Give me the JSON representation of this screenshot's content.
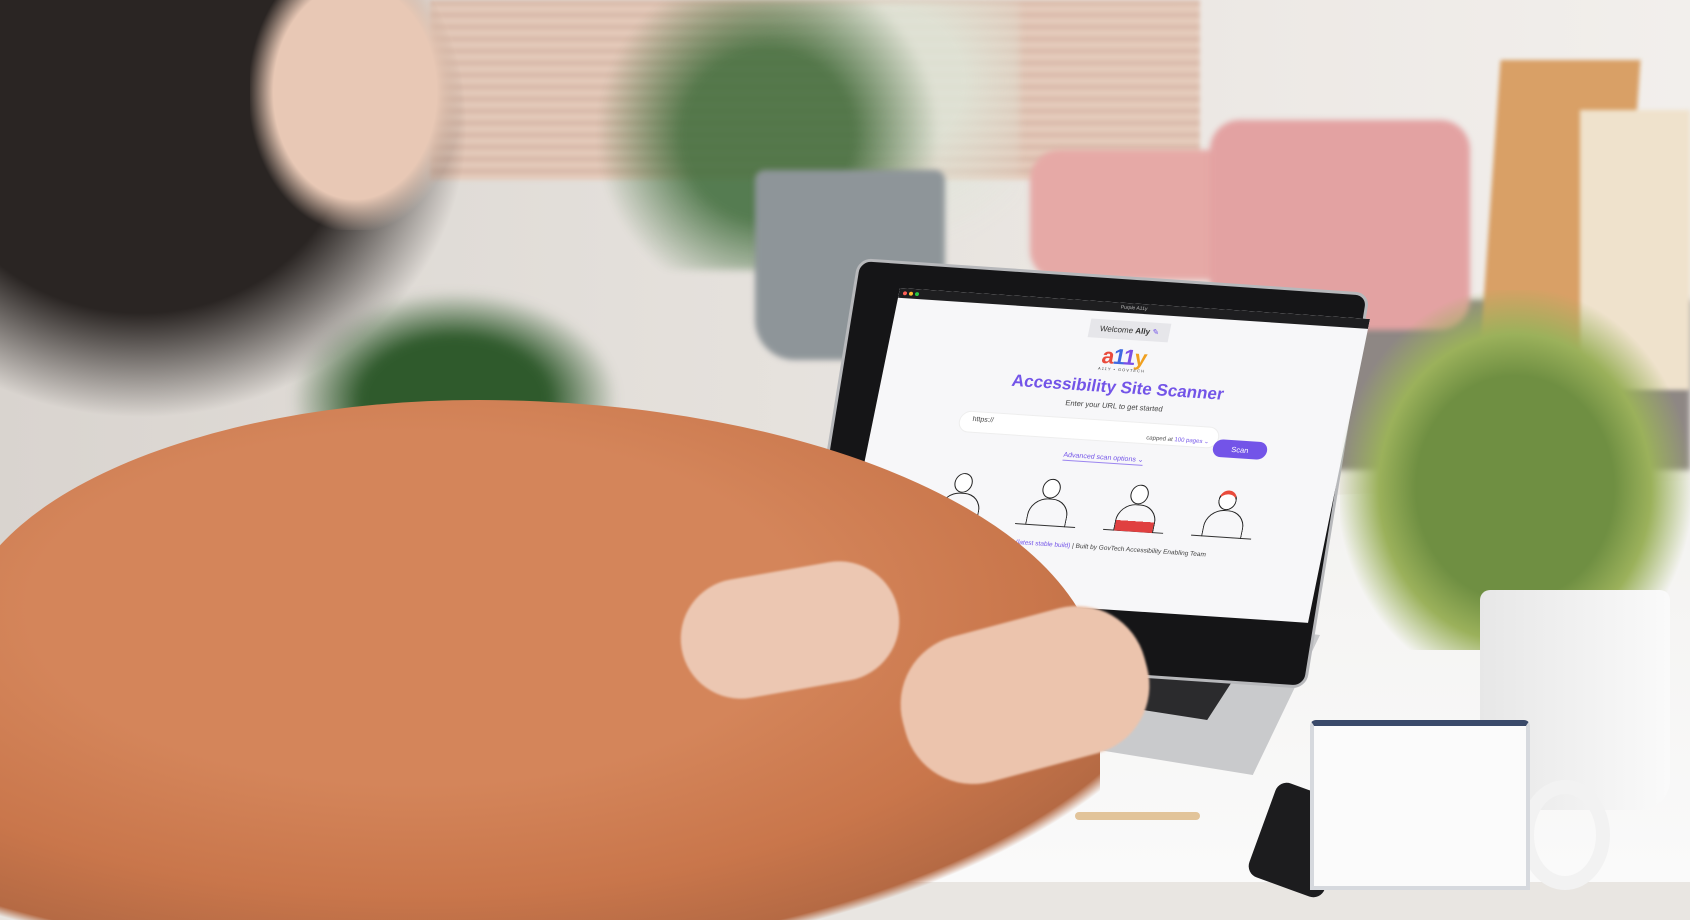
{
  "window": {
    "title": "Purple A11y"
  },
  "app": {
    "welcome_prefix": "Welcome",
    "welcome_name": "Ally",
    "logo_letters": [
      "a",
      "1",
      "1",
      "y"
    ],
    "logo_sub": "A11Y • GOVTECH",
    "heading": "Accessibility Site Scanner",
    "subheading": "Enter your URL to get started",
    "url_placeholder": "https://",
    "cap_prefix": "capped at",
    "cap_value": "100 pages",
    "scan_button": "Scan",
    "advanced_options": "Advanced scan options",
    "version": "Version 0.9.52 (latest stable build)",
    "built_by": "| Built by GovTech Accessibility Enabling Team"
  },
  "colors": {
    "accent": "#7354e8"
  }
}
